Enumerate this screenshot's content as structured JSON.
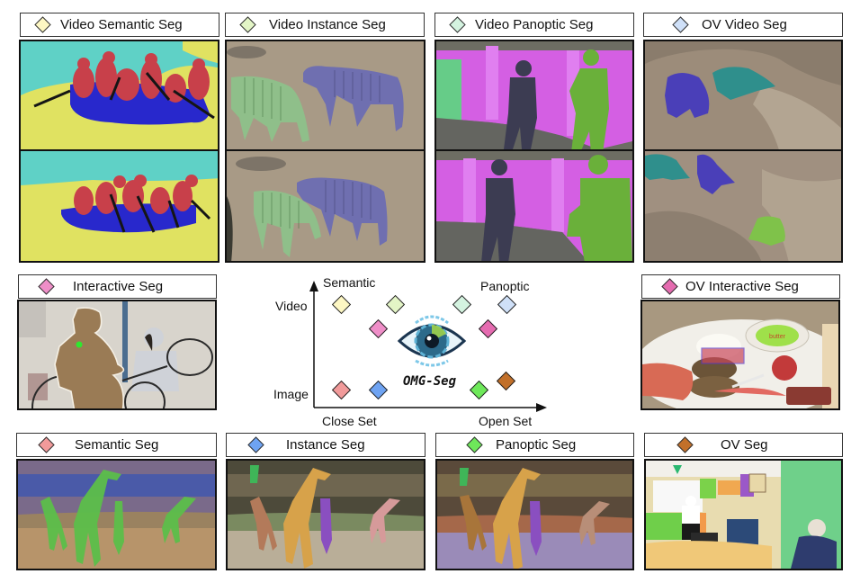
{
  "tasks": {
    "video_semantic": {
      "label": "Video Semantic Seg",
      "color": "#fdf7c3"
    },
    "video_instance": {
      "label": "Video Instance Seg",
      "color": "#e3f5c6"
    },
    "video_panoptic": {
      "label": "Video Panoptic Seg",
      "color": "#d4f3e0"
    },
    "ov_video": {
      "label": "OV Video Seg",
      "color": "#cfe0f8"
    },
    "interactive": {
      "label": "Interactive Seg",
      "color": "#ef8ec8"
    },
    "ov_interactive": {
      "label": "OV Interactive Seg",
      "color": "#e56bb0"
    },
    "semantic": {
      "label": "Semantic Seg",
      "color": "#f19a9a"
    },
    "instance": {
      "label": "Instance Seg",
      "color": "#6ea3f2"
    },
    "panoptic": {
      "label": "Panoptic Seg",
      "color": "#6ee85a"
    },
    "ov": {
      "label": "OV Seg",
      "color": "#c2702a"
    }
  },
  "center_diagram": {
    "y_axis_top": "Video",
    "y_axis_bottom": "Image",
    "x_axis_left": "Close Set",
    "x_axis_right": "Open Set",
    "top_left_label": "Semantic",
    "top_right_label": "Panoptic",
    "logo_text": "OMG-Seg",
    "logo_icon": "eye-icon"
  },
  "images": {
    "ov_interactive_annotation": "butter"
  },
  "colors": {
    "mask_red": "#c93a48",
    "mask_blue": "#2a2ad0",
    "mask_yellow": "#e6e86a",
    "mask_cyan": "#5cd6c4",
    "mask_magenta": "#d65ae8",
    "mask_green": "#7fc24a",
    "mask_purple": "#6b4fd0",
    "mask_teal": "#2f8f8c"
  }
}
